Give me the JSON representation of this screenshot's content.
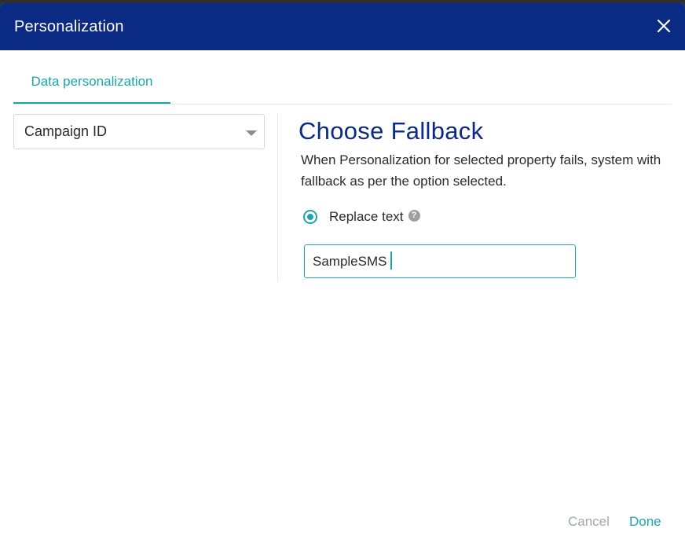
{
  "dialog": {
    "title": "Personalization",
    "close_icon": "close-icon"
  },
  "tabs": [
    {
      "label": "Data personalization",
      "active": true
    }
  ],
  "left": {
    "property_select": {
      "value": "Campaign ID"
    }
  },
  "right": {
    "heading": "Choose Fallback",
    "description": "When Personalization for selected property fails, system with fallback as per the option selected.",
    "option": {
      "label": "Replace text",
      "selected": true
    },
    "input": {
      "value": "SampleSMS"
    }
  },
  "footer": {
    "cancel_label": "Cancel",
    "done_label": "Done"
  },
  "colors": {
    "header_bg": "#0b2a84",
    "accent": "#1ba6ad",
    "heading": "#0b2a84"
  }
}
